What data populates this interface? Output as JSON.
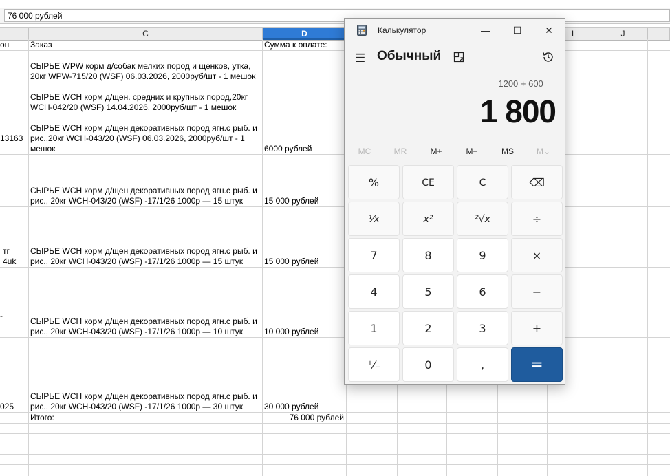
{
  "formula_bar": {
    "value": "76 000 рублей"
  },
  "columns": [
    {
      "label": ""
    },
    {
      "label": "C"
    },
    {
      "label": "D"
    },
    {
      "label": ""
    },
    {
      "label": ""
    },
    {
      "label": ""
    },
    {
      "label": ""
    },
    {
      "label": "I"
    },
    {
      "label": "J"
    },
    {
      "label": ""
    }
  ],
  "rows": [
    {
      "b": "он",
      "c": "Заказ",
      "d": "Сумма к оплате:"
    },
    {
      "b": "13163",
      "c": "СЫРЬЕ WPW корм д/собак мелких пород и щенков, утка,\n20кг WPW-715/20 (WSF) 06.03.2026, 2000руб/шт - 1 мешок\n\nСЫРЬЕ WCH корм д/щен. средних и крупных пород,20кг\nWCH-042/20 (WSF) 14.04.2026, 2000руб/шт - 1 мешок\n\nСЫРЬЕ WCH корм д/щен декоративных пород ягн.с рыб. и\nрис.,20кг WCH-043/20 (WSF) 06.03.2026, 2000руб/шт - 1\nмешок",
      "d": "6000 рублей"
    },
    {
      "b": "",
      "c": "СЫРЬЕ WCH корм д/щен декоративных пород ягн.с рыб. и\nрис., 20кг WCH-043/20 (WSF) -17/1/26 1000р — 15 штук",
      "d": "15 000 рублей"
    },
    {
      "b": "тг\n4uk",
      "c": "СЫРЬЕ WCH корм д/щен декоративных пород ягн.с рыб. и\nрис., 20кг WCH-043/20 (WSF) -17/1/26 1000р — 15 штук",
      "d": "15 000 рублей"
    },
    {
      "b": "-",
      "c": "СЫРЬЕ WCH корм д/щен декоративных пород ягн.с рыб. и\nрис., 20кг WCH-043/20 (WSF) -17/1/26 1000р — 10 штук",
      "d": "10 000 рублей"
    },
    {
      "b": "025",
      "c": "СЫРЬЕ WCH корм д/щен декоративных пород ягн.с рыб. и\nрис., 20кг WCH-043/20 (WSF) -17/1/26 1000р — 30 штук",
      "d": "30 000 рублей"
    },
    {
      "b": "",
      "c": "Итого:",
      "d": "76 000 рублей"
    }
  ],
  "calculator": {
    "window_title": "Калькулятор",
    "minimize": "—",
    "maximize": "☐",
    "close": "✕",
    "menu_icon": "☰",
    "mode": "Обычный",
    "expression": "1200 + 600 =",
    "result": "1 800",
    "memory": [
      "MC",
      "MR",
      "M+",
      "M−",
      "MS",
      "M⌄"
    ],
    "keys": {
      "percent": "%",
      "ce": "CE",
      "c": "C",
      "backspace": "⌫",
      "reciprocal": "¹⁄x",
      "square": "x²",
      "sqrt": "²√x",
      "divide": "÷",
      "seven": "7",
      "eight": "8",
      "nine": "9",
      "multiply": "×",
      "four": "4",
      "five": "5",
      "six": "6",
      "minus": "−",
      "one": "1",
      "two": "2",
      "three": "3",
      "plus": "+",
      "negate": "⁺⁄₋",
      "zero": "0",
      "decimal": ",",
      "equals": "="
    },
    "colors": {
      "accent": "#1f5c9e",
      "background": "#f3f3f3"
    }
  }
}
